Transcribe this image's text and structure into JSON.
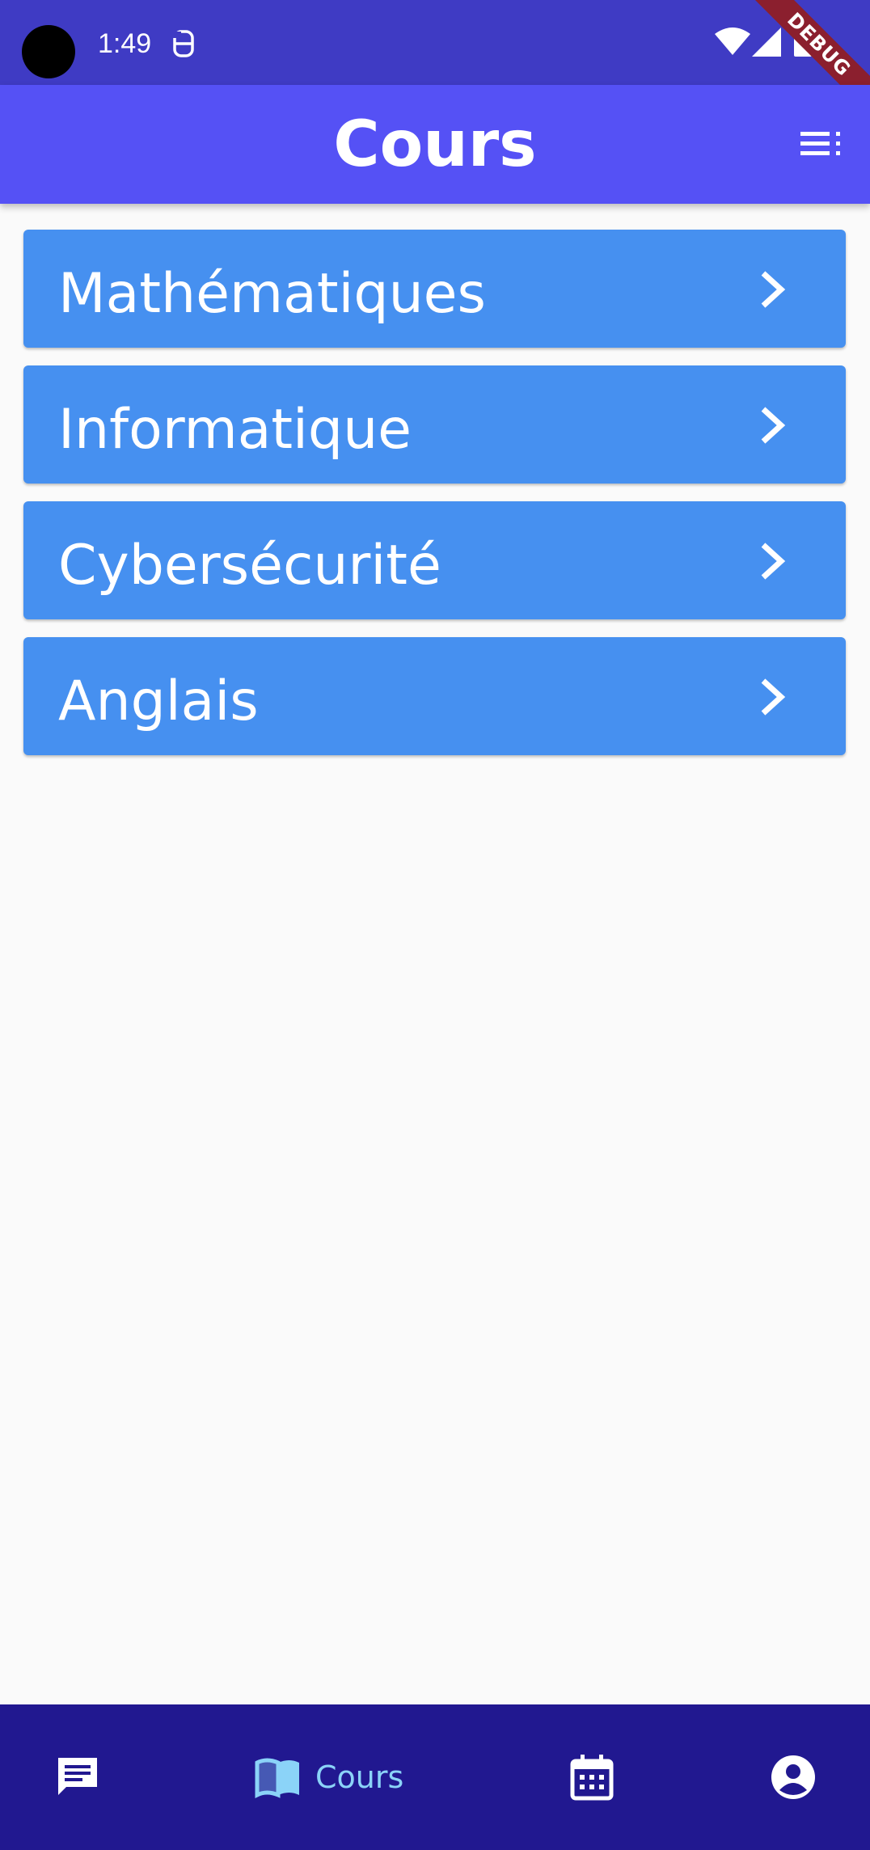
{
  "status_bar": {
    "time": "1:49",
    "debug_label": "DEBUG"
  },
  "app_bar": {
    "title": "Cours",
    "menu_icon": "sort-menu-icon"
  },
  "courses": [
    {
      "label": "Mathématiques",
      "icon": "chevron-right-icon"
    },
    {
      "label": "Informatique",
      "icon": "chevron-right-icon"
    },
    {
      "label": "Cybersécurité",
      "icon": "chevron-right-icon"
    },
    {
      "label": "Anglais",
      "icon": "chevron-right-icon"
    }
  ],
  "bottom_nav": {
    "items": [
      {
        "icon": "chat-icon",
        "label": ""
      },
      {
        "icon": "book-icon",
        "label": "Cours",
        "active": true
      },
      {
        "icon": "calendar-icon",
        "label": ""
      },
      {
        "icon": "account-icon",
        "label": ""
      }
    ]
  },
  "colors": {
    "status_bar": "#3f3bc4",
    "app_bar": "#5551f5",
    "course_item": "#4690f0",
    "bottom_nav": "#211890",
    "active_nav": "#8bd3f8",
    "background": "#fafafa"
  }
}
